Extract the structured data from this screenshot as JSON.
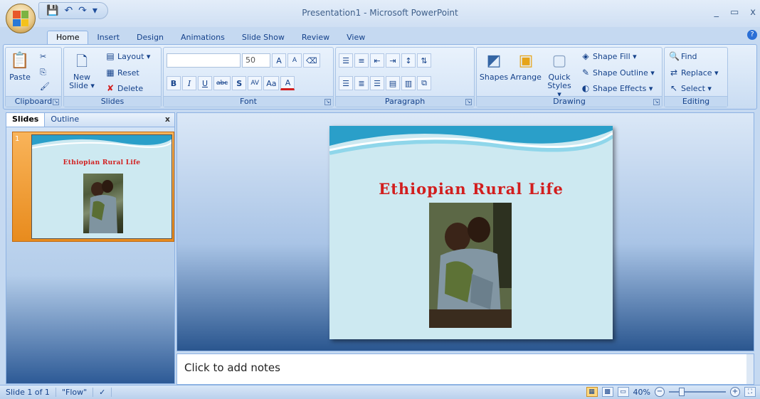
{
  "window": {
    "title": "Presentation1 - Microsoft PowerPoint",
    "minimize": "_",
    "maximize": "▭",
    "close": "x"
  },
  "qat": {
    "save": "💾",
    "undo": "↶",
    "redo": "↷",
    "customize": "▾"
  },
  "tabs": [
    {
      "label": "Home",
      "active": true
    },
    {
      "label": "Insert"
    },
    {
      "label": "Design"
    },
    {
      "label": "Animations"
    },
    {
      "label": "Slide Show"
    },
    {
      "label": "Review"
    },
    {
      "label": "View"
    }
  ],
  "ribbon": {
    "clipboard": {
      "label": "Clipboard",
      "paste": "Paste",
      "cut_icon": "cut-icon",
      "copy_icon": "copy-icon",
      "painter_icon": "format-painter-icon"
    },
    "slides": {
      "label": "Slides",
      "new_slide_line1": "New",
      "new_slide_line2": "Slide ▾",
      "layout": "Layout ▾",
      "reset": "Reset",
      "delete": "Delete"
    },
    "font": {
      "label": "Font",
      "font_name": "",
      "font_size": "50",
      "bold": "B",
      "italic": "I",
      "underline": "U",
      "strike": "abc",
      "shadow": "S",
      "spacing": "AV",
      "case": "Aa",
      "color": "A",
      "grow": "A",
      "shrink": "A"
    },
    "paragraph": {
      "label": "Paragraph"
    },
    "drawing": {
      "label": "Drawing",
      "shapes": "Shapes",
      "arrange": "Arrange",
      "quick_styles_1": "Quick",
      "quick_styles_2": "Styles ▾",
      "shape_fill": "Shape Fill ▾",
      "shape_outline": "Shape Outline ▾",
      "shape_effects": "Shape Effects ▾"
    },
    "editing": {
      "label": "Editing",
      "find": "Find",
      "replace": "Replace ▾",
      "select": "Select ▾"
    }
  },
  "slides_panel": {
    "tab_slides": "Slides",
    "tab_outline": "Outline",
    "close": "x",
    "thumbs": [
      {
        "number": "1",
        "title": "Ethiopian Rural Life"
      }
    ]
  },
  "slide": {
    "title": "Ethiopian Rural Life"
  },
  "notes": {
    "placeholder": "Click to add notes"
  },
  "status": {
    "slide_info": "Slide 1 of 1",
    "theme": "\"Flow\"",
    "zoom": "40%",
    "zoom_minus": "−",
    "zoom_plus": "+"
  },
  "colors": {
    "title_red": "#d21e1e",
    "slide_bg": "#cde9f1",
    "accent_orange": "#f0a030"
  }
}
